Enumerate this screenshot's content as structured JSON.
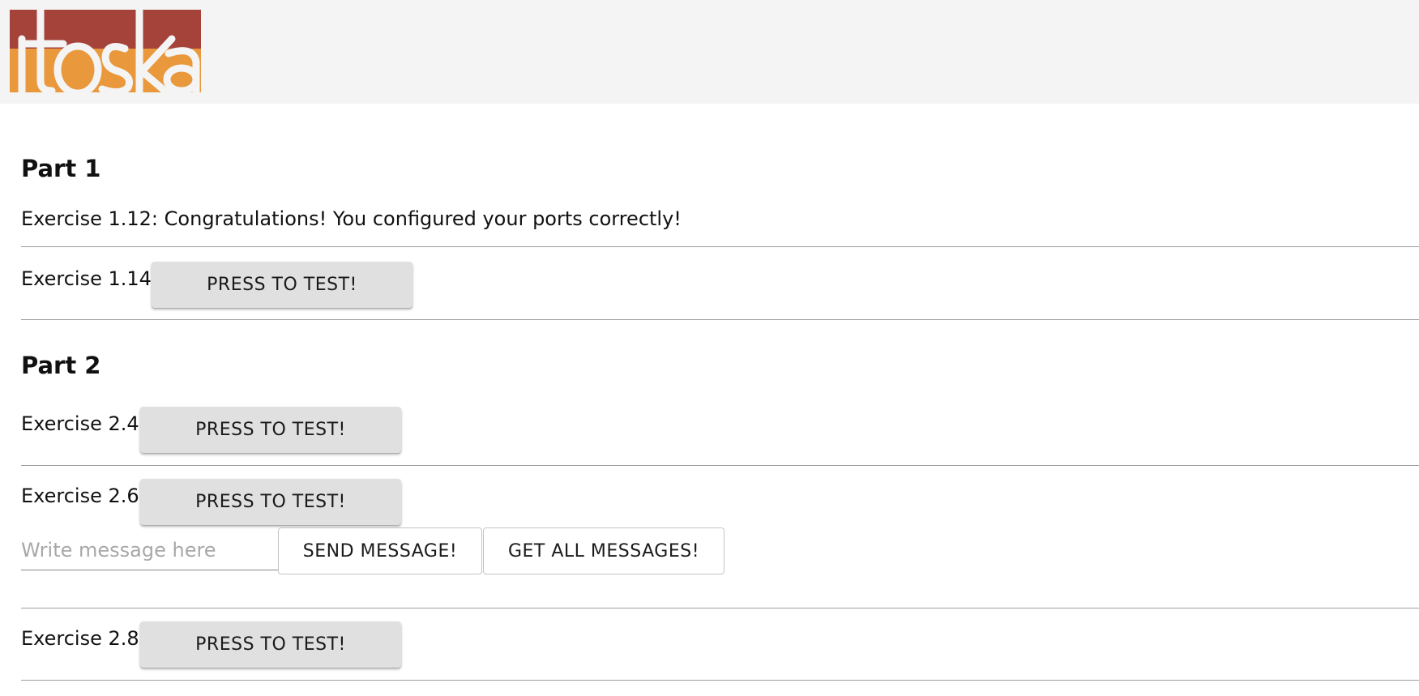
{
  "header": {
    "logo_text": "itoska",
    "colors": {
      "logo_red": "#a5423a",
      "logo_orange": "#e9983b",
      "header_bg": "#f4f4f4"
    }
  },
  "part1": {
    "title": "Part 1",
    "ex_1_12": {
      "label": "Exercise 1.12:",
      "message": "Congratulations! You configured your ports correctly!"
    },
    "ex_1_14": {
      "label": "Exercise 1.14:",
      "button": "PRESS TO TEST!"
    }
  },
  "part2": {
    "title": "Part 2",
    "ex_2_4": {
      "label": "Exercise 2.4:",
      "button": "PRESS TO TEST!"
    },
    "ex_2_6": {
      "label": "Exercise 2.6:",
      "button": "PRESS TO TEST!",
      "input_placeholder": "Write message here",
      "input_value": "",
      "send_button": "SEND MESSAGE!",
      "get_button": "GET ALL MESSAGES!"
    },
    "ex_2_8": {
      "label": "Exercise 2.8:",
      "button": "PRESS TO TEST!"
    }
  }
}
